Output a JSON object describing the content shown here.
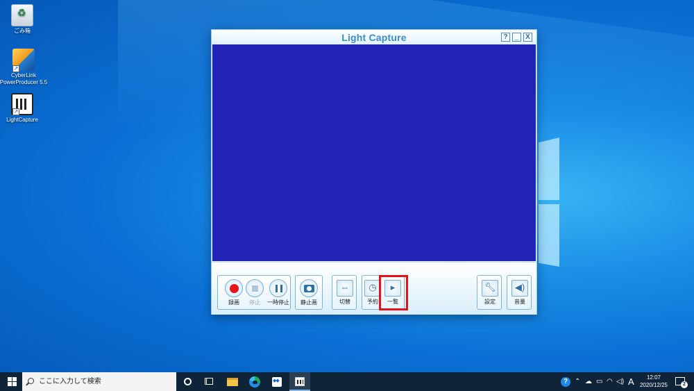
{
  "desktop": {
    "icons": [
      {
        "label": "ごみ箱"
      },
      {
        "label": "CyberLink PowerProducer 5.5"
      },
      {
        "label": "LightCapture"
      }
    ]
  },
  "app": {
    "title": "Light Capture",
    "title_buttons": {
      "help": "?",
      "minimize": "_",
      "close": "X"
    },
    "buttons": {
      "record": "録画",
      "stop": "停止",
      "pause": "一時停止",
      "snapshot": "静止画",
      "switch": "切替",
      "schedule": "予約",
      "list": "一覧",
      "settings": "設定",
      "volume": "音量"
    },
    "colors": {
      "preview": "#2222b4",
      "highlight": "#e2141a",
      "record": "#e8131b"
    }
  },
  "taskbar": {
    "search_placeholder": "ここに入力して検索",
    "tray": {
      "ime": "A",
      "help": "?"
    },
    "clock": {
      "time": "12:07",
      "date": "2020/12/25"
    },
    "notifications": "2"
  }
}
